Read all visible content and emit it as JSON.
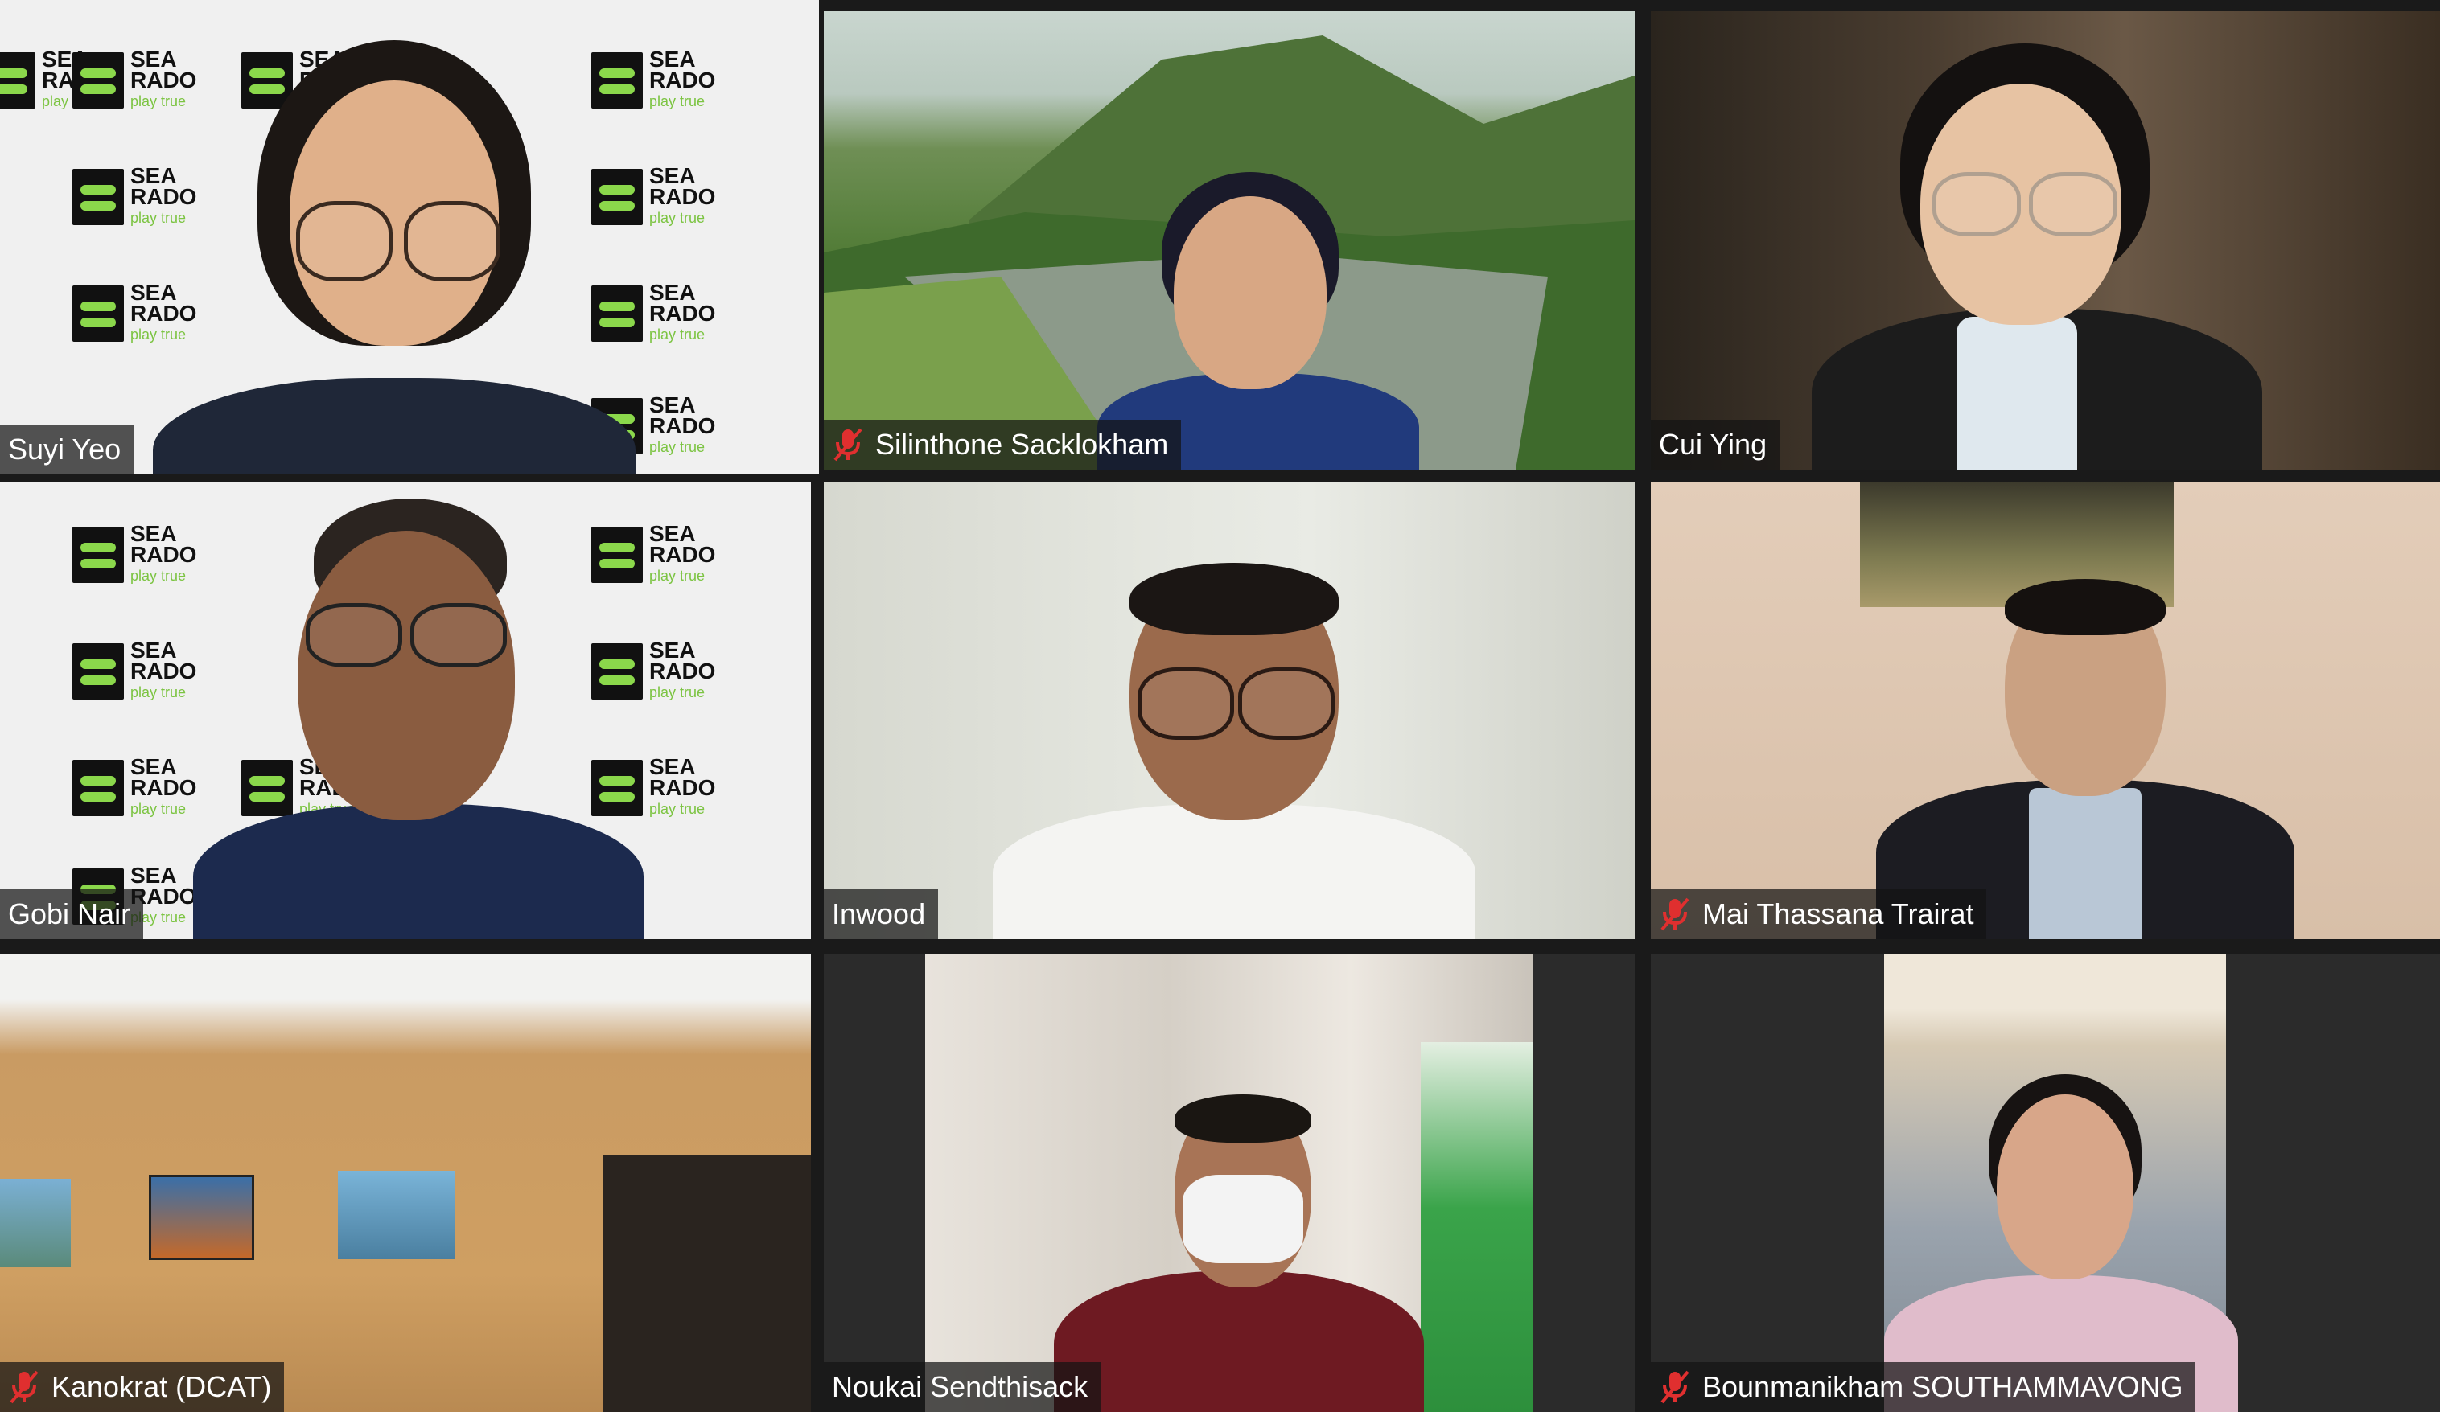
{
  "participants": [
    {
      "name": "Suyi Yeo",
      "muted": false,
      "speaking": true
    },
    {
      "name": "Silinthone Sacklokham",
      "muted": true,
      "speaking": false
    },
    {
      "name": "Cui Ying",
      "muted": false,
      "speaking": false
    },
    {
      "name": "Gobi Nair",
      "muted": false,
      "speaking": false
    },
    {
      "name": "Inwood",
      "muted": false,
      "speaking": false
    },
    {
      "name": "Mai Thassana Trairat",
      "muted": true,
      "speaking": false
    },
    {
      "name": "Kanokrat (DCAT)",
      "muted": true,
      "speaking": false
    },
    {
      "name": "Noukai Sendthisack",
      "muted": false,
      "speaking": false
    },
    {
      "name": "Bounmanikham SOUTHAMMAVONG",
      "muted": true,
      "speaking": false
    }
  ],
  "backdrop_logo": {
    "line1": "SEA",
    "line2": "RADO",
    "tagline": "play true"
  },
  "colors": {
    "active_speaker_border": "#e8f06a",
    "mute_icon": "#e02f2f",
    "name_tag_bg": "rgba(20,20,20,0.72)",
    "gallery_bg": "#1a1a1a"
  }
}
